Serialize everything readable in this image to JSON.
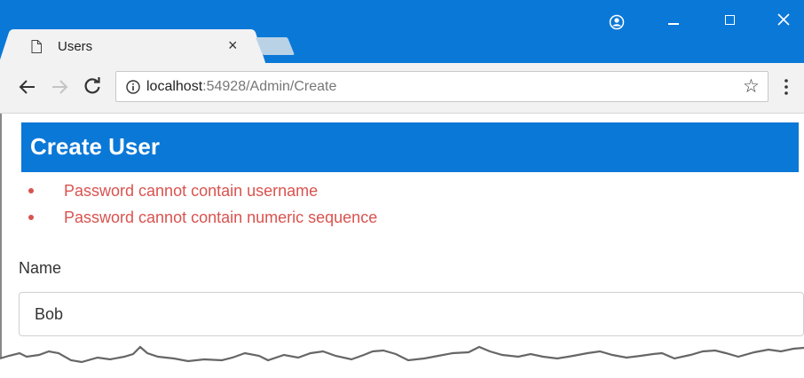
{
  "browser": {
    "tab": {
      "title": "Users",
      "close_glyph": "×",
      "icon": "page-icon"
    },
    "window_controls": {
      "account_icon": "account-icon",
      "minimize_icon": "minimize-icon",
      "maximize_icon": "maximize-icon",
      "close_icon": "close-icon"
    },
    "toolbar": {
      "back_icon": "back-arrow-icon",
      "forward_icon": "forward-arrow-icon",
      "reload_icon": "reload-icon",
      "url_host": "localhost",
      "url_rest": ":54928/Admin/Create",
      "star_glyph": "☆",
      "menu_icon": "more-vert-icon"
    }
  },
  "page": {
    "header": {
      "title": "Create User",
      "color": "#0a78d7"
    },
    "errors": [
      "Password cannot contain username",
      "Password cannot contain numeric sequence"
    ],
    "error_color": "#d9534f",
    "form": {
      "name_label": "Name",
      "name_value": "Bob"
    }
  }
}
